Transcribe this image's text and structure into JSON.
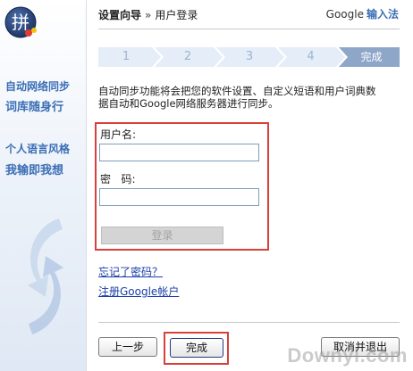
{
  "header": {
    "title": "设置向导",
    "separator": "»",
    "subtitle": "用户登录"
  },
  "brand": {
    "google": "Google",
    "ime": "输入法"
  },
  "sidebar": {
    "feature1": [
      "自动网络同步",
      "词库随身行"
    ],
    "feature2": [
      "个人语言风格",
      "我输即我想"
    ]
  },
  "steps": [
    {
      "label": "1",
      "active": false
    },
    {
      "label": "2",
      "active": false
    },
    {
      "label": "3",
      "active": false
    },
    {
      "label": "4",
      "active": false
    },
    {
      "label": "完成",
      "active": true
    }
  ],
  "description": [
    "自动同步功能将会把您的软件设置、自定义短语和用户词典数",
    "据自动和Google网络服务器进行同步。"
  ],
  "form": {
    "username_label": "用户名:",
    "username_value": "",
    "password_label": "密   码:",
    "password_value": "",
    "login_button": "登录"
  },
  "links": {
    "forgot": "忘记了密码？",
    "register": "注册Google帐户"
  },
  "footer": {
    "back": "上一步",
    "finish": "完成",
    "cancel": "取消并退出"
  },
  "watermark": "Downyi.com",
  "colors": {
    "accent": "#3b6eb5",
    "highlight": "#d9403a",
    "step_bg": "#e4edf8",
    "step_active": "#8ea7c8"
  }
}
